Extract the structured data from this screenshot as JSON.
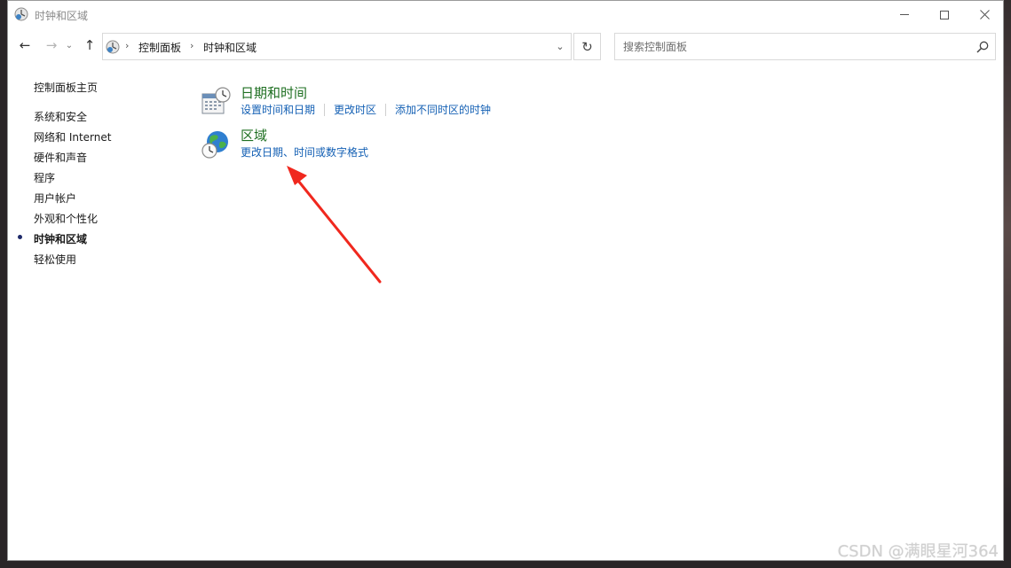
{
  "window": {
    "title": "时钟和区域",
    "controls": {
      "minimize": "minimize-icon",
      "maximize": "maximize-icon",
      "close": "close-icon"
    }
  },
  "nav": {
    "back_icon": "←",
    "forward_icon": "→",
    "recent_icon": "⌄",
    "up_icon": "↑",
    "breadcrumb": [
      "控制面板",
      "时钟和区域"
    ],
    "separator": "›",
    "dropdown_icon": "⌄",
    "refresh_icon": "↻",
    "search_placeholder": "搜索控制面板"
  },
  "sidebar": {
    "home": "控制面板主页",
    "items": [
      {
        "label": "系统和安全"
      },
      {
        "label": "网络和 Internet"
      },
      {
        "label": "硬件和声音"
      },
      {
        "label": "程序"
      },
      {
        "label": "用户帐户"
      },
      {
        "label": "外观和个性化"
      },
      {
        "label": "时钟和区域",
        "active": true
      },
      {
        "label": "轻松使用"
      }
    ]
  },
  "main": {
    "categories": [
      {
        "title": "日期和时间",
        "icon": "calendar-clock-icon",
        "links": [
          "设置时间和日期",
          "更改时区",
          "添加不同时区的时钟"
        ]
      },
      {
        "title": "区域",
        "icon": "globe-clock-icon",
        "links": [
          "更改日期、时间或数字格式"
        ]
      }
    ]
  },
  "watermark": "CSDN @满眼星河364",
  "colors": {
    "category_title": "#1e6f21",
    "link": "#1460b4",
    "annotation_arrow": "#f0281e"
  }
}
